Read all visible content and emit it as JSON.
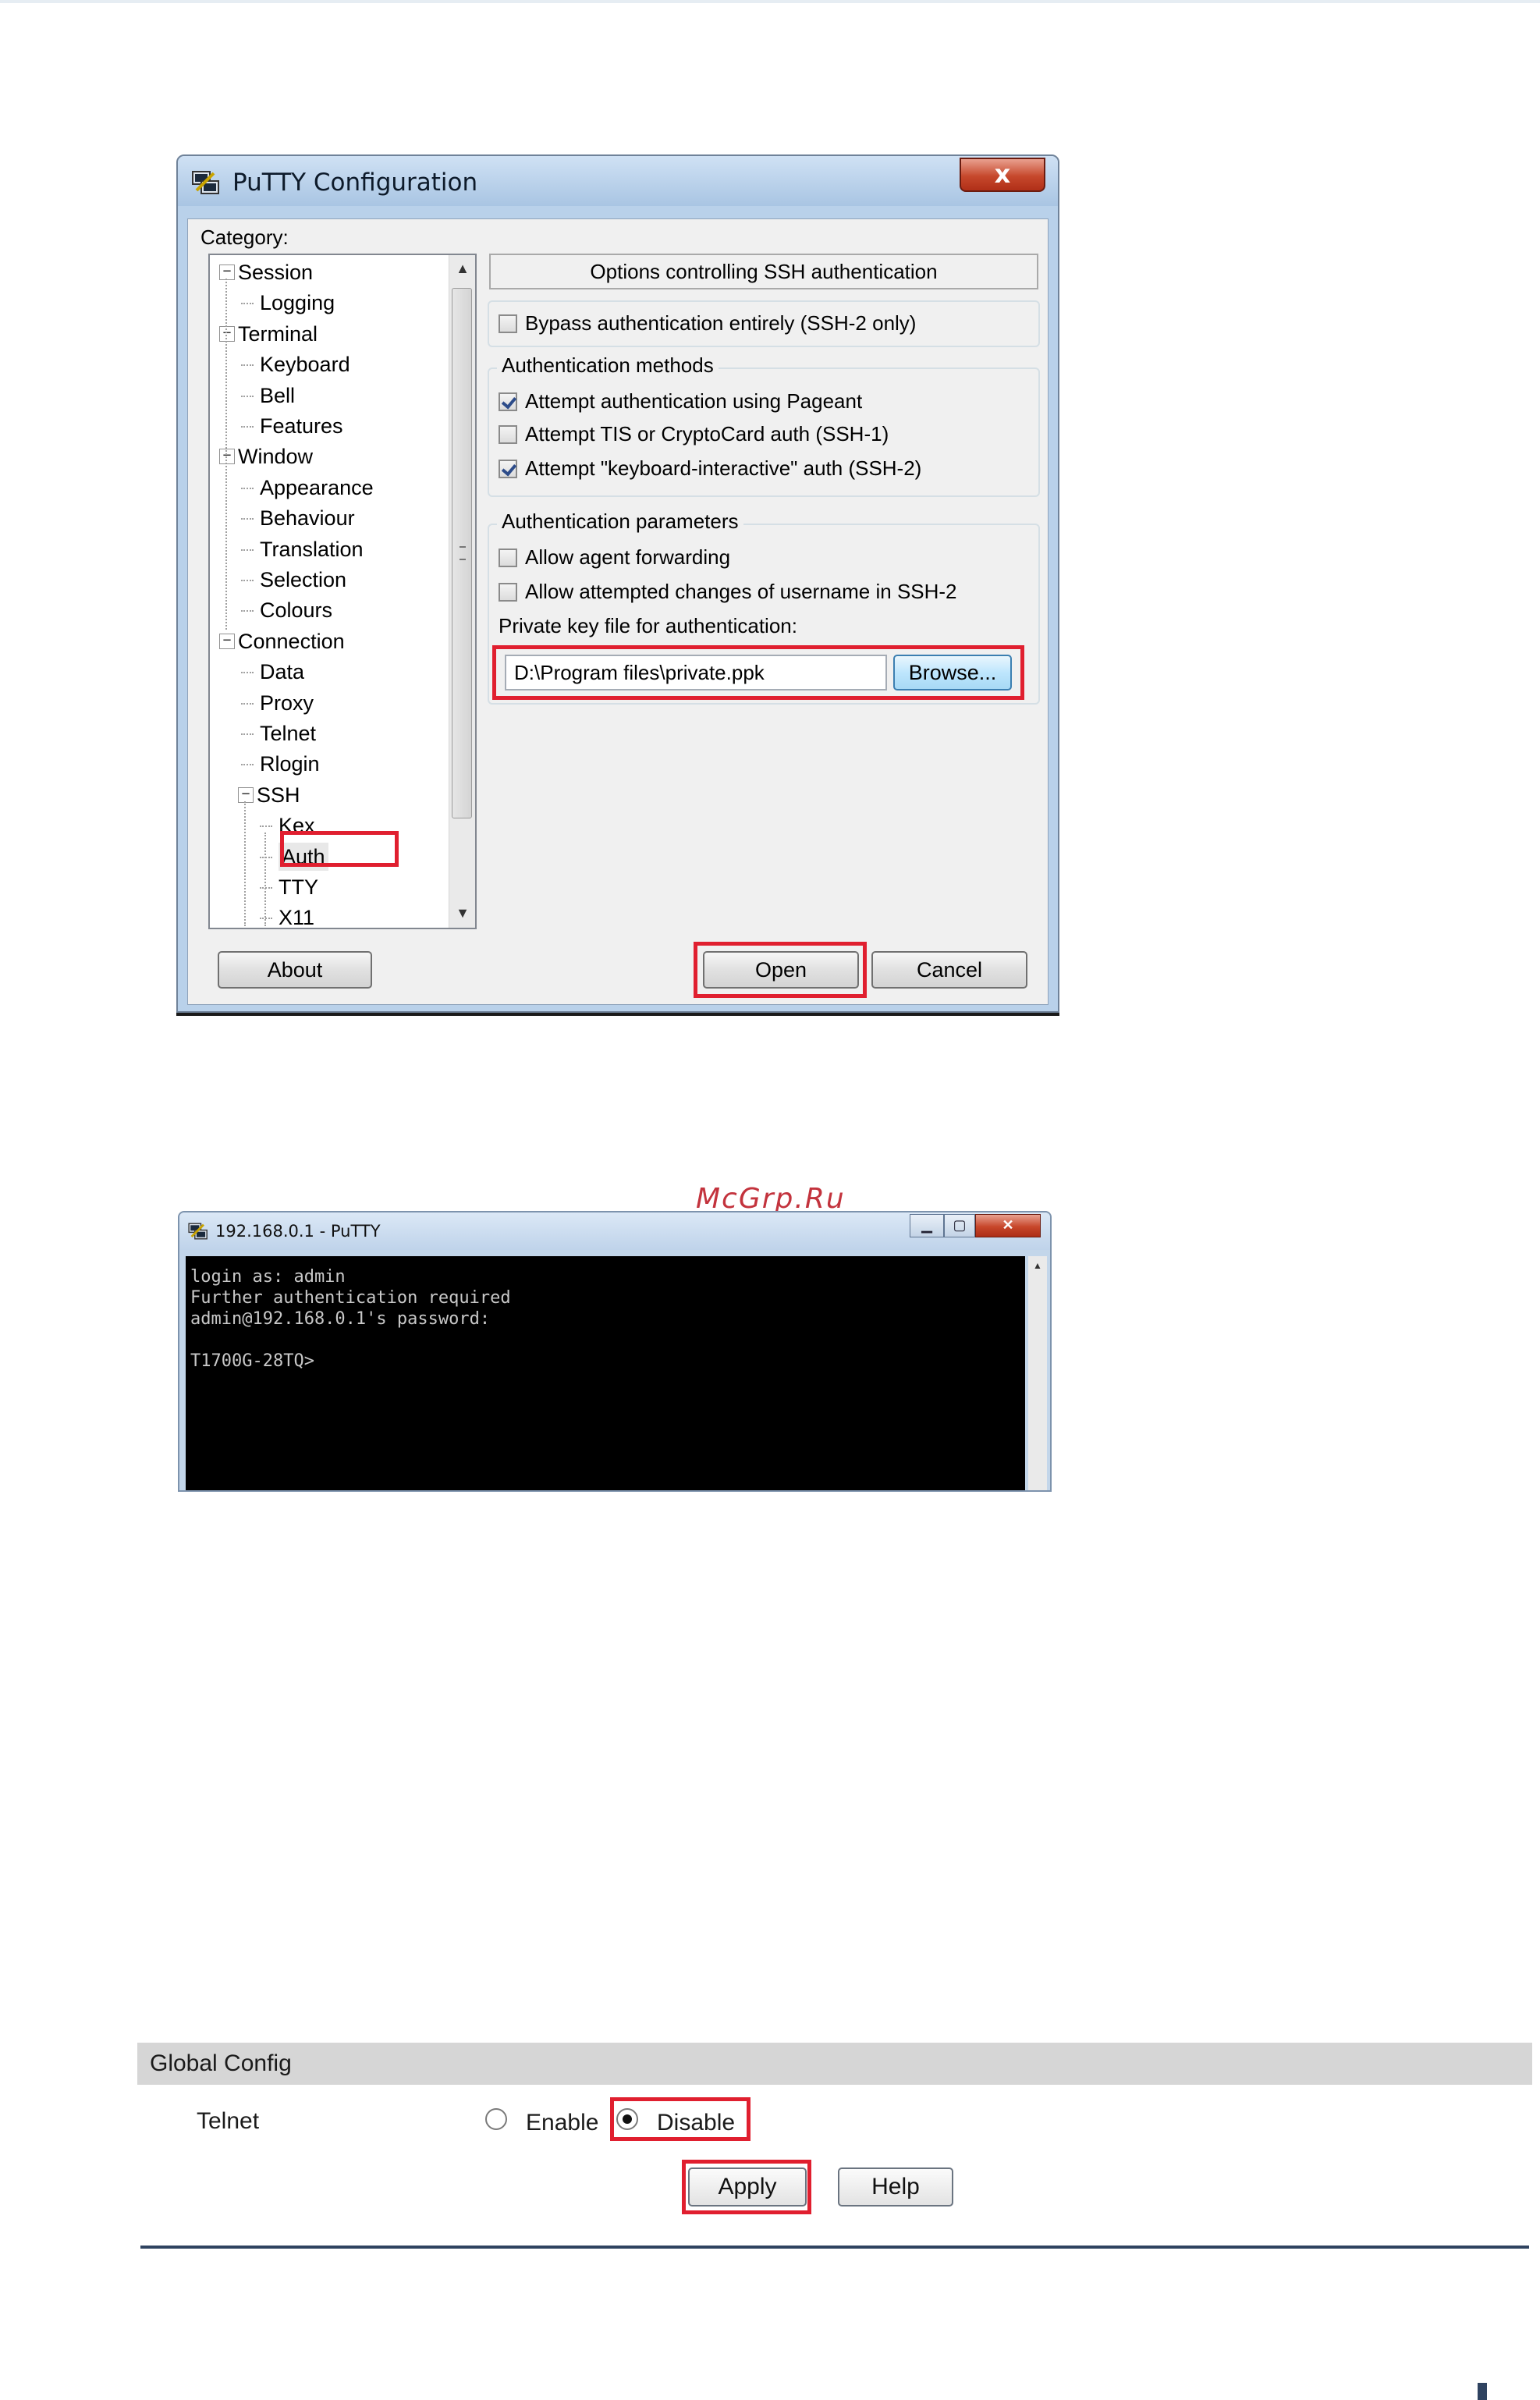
{
  "cfg_window": {
    "title": "PuTTY Configuration",
    "close_glyph": "x",
    "icon": "putty-icon",
    "category_label": "Category:",
    "tree": [
      {
        "label": "Session",
        "level": 0,
        "toggle": "−"
      },
      {
        "label": "Logging",
        "level": 1
      },
      {
        "label": "Terminal",
        "level": 0,
        "toggle": "−"
      },
      {
        "label": "Keyboard",
        "level": 1
      },
      {
        "label": "Bell",
        "level": 1
      },
      {
        "label": "Features",
        "level": 1
      },
      {
        "label": "Window",
        "level": 0,
        "toggle": "−"
      },
      {
        "label": "Appearance",
        "level": 1
      },
      {
        "label": "Behaviour",
        "level": 1
      },
      {
        "label": "Translation",
        "level": 1
      },
      {
        "label": "Selection",
        "level": 1
      },
      {
        "label": "Colours",
        "level": 1
      },
      {
        "label": "Connection",
        "level": 0,
        "toggle": "−"
      },
      {
        "label": "Data",
        "level": 1
      },
      {
        "label": "Proxy",
        "level": 1
      },
      {
        "label": "Telnet",
        "level": 1
      },
      {
        "label": "Rlogin",
        "level": 1
      },
      {
        "label": "SSH",
        "level": 1,
        "toggle": "−"
      },
      {
        "label": "Kex",
        "level": 2
      },
      {
        "label": "Auth",
        "level": 2,
        "selected": true
      },
      {
        "label": "TTY",
        "level": 2
      },
      {
        "label": "X11",
        "level": 2
      }
    ],
    "panel_title": "Options controlling SSH authentication",
    "bypass": {
      "label": "Bypass authentication entirely (SSH-2 only)",
      "checked": false
    },
    "auth_methods": {
      "title": "Authentication methods",
      "options": [
        {
          "label": "Attempt authentication using Pageant",
          "checked": true
        },
        {
          "label": "Attempt TIS or CryptoCard auth (SSH-1)",
          "checked": false
        },
        {
          "label": "Attempt \"keyboard-interactive\" auth (SSH-2)",
          "checked": true
        }
      ]
    },
    "auth_params": {
      "title": "Authentication parameters",
      "options": [
        {
          "label": "Allow agent forwarding",
          "checked": false
        },
        {
          "label": "Allow attempted changes of username in SSH-2",
          "checked": false
        }
      ],
      "key_file_label": "Private key file for authentication:",
      "key_file_value": "D:\\Program files\\private.ppk",
      "browse_label": "Browse..."
    },
    "about_label": "About",
    "open_label": "Open",
    "cancel_label": "Cancel"
  },
  "terminal": {
    "title": "192.168.0.1 - PuTTY",
    "icon": "putty-icon",
    "lines": [
      "login as: admin",
      "Further authentication required",
      "admin@192.168.0.1's password:",
      "",
      "T1700G-28TQ>"
    ]
  },
  "watermark": "McGrp.Ru",
  "global_config": {
    "header": "Global Config",
    "telnet_label": "Telnet",
    "enable_label": "Enable",
    "disable_label": "Disable",
    "selected": "Disable",
    "apply_label": "Apply",
    "help_label": "Help"
  },
  "colors": {
    "highlight": "#e01f2f",
    "rule": "#2f4360"
  }
}
